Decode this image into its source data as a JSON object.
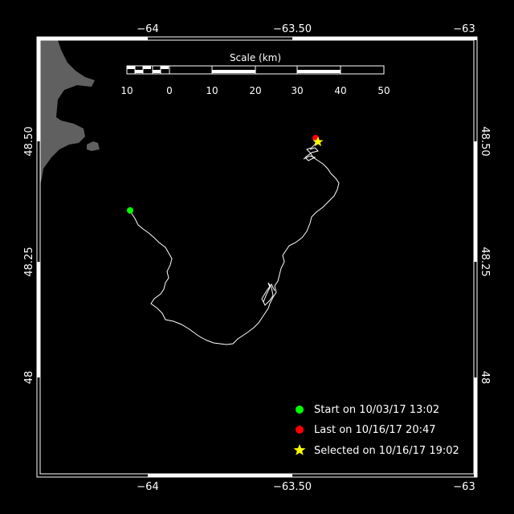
{
  "map": {
    "x_axis": {
      "ticks": [
        "−64",
        "−63.50",
        "−63"
      ],
      "values": [
        -64,
        -63.5,
        -63
      ]
    },
    "y_axis": {
      "ticks": [
        "48.50",
        "48.25",
        "48"
      ],
      "values": [
        48.5,
        48.25,
        48.0
      ]
    },
    "scale_bar": {
      "title": "Scale (km)",
      "labels": [
        "10",
        "0",
        "10",
        "20",
        "30",
        "40",
        "50"
      ]
    },
    "track": {
      "start": {
        "lon": -64.11,
        "lat": 48.35
      },
      "last": {
        "lon": -63.42,
        "lat": 48.5
      },
      "selected": {
        "lon": -63.41,
        "lat": 48.495
      }
    },
    "legend": [
      {
        "symbol": "circle",
        "color": "#00ff00",
        "label": "Start on 10/03/17 13:02"
      },
      {
        "symbol": "circle",
        "color": "#ff0000",
        "label": "Last on 10/16/17 20:47"
      },
      {
        "symbol": "star",
        "color": "#ffff00",
        "label": "Selected on 10/16/17 19:02"
      }
    ],
    "colors": {
      "background": "#000000",
      "land": "#606060",
      "track": "#ffffff",
      "frame": "#ffffff"
    }
  }
}
